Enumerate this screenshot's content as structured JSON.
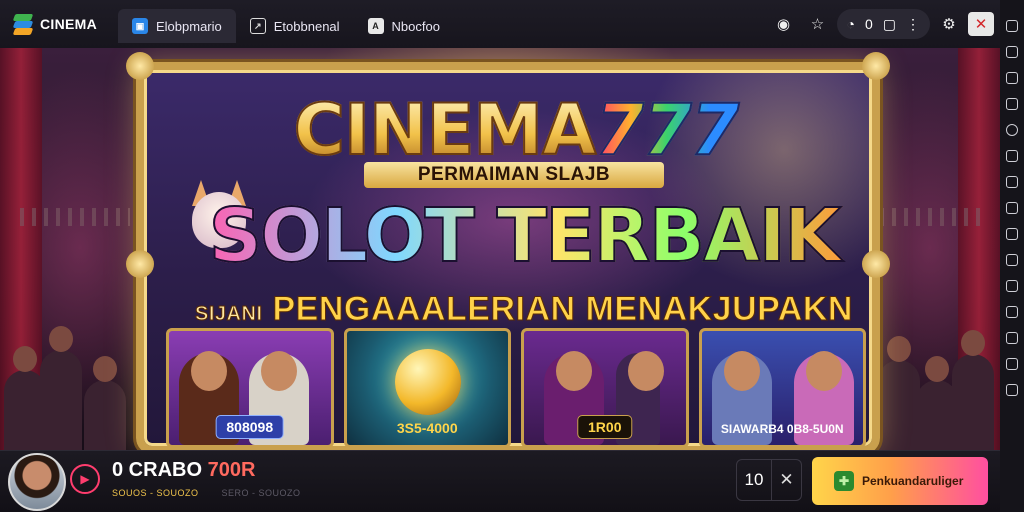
{
  "header": {
    "brand": "CINEMA",
    "tabs": [
      {
        "label": "Elobpmario",
        "icon": "app-icon"
      },
      {
        "label": "Etobbnenal",
        "icon": "window-icon"
      },
      {
        "label": "Nbocfoo",
        "icon": "document-icon"
      }
    ],
    "toolbar": {
      "share_icon": "share-icon",
      "star_icon": "star-icon",
      "pill_value": "0"
    }
  },
  "banner": {
    "brand_word": "CINEMA",
    "brand_number": "777",
    "subtitle": "PERMAIMAN SLAJB",
    "headline": "SOLOT TERBAIK",
    "tagline_prefix": "SIJANI",
    "tagline": "PENGAAALERIAN MENAKJUPAKN",
    "cards": [
      {
        "label": "808098",
        "label_bg": "#2d3fa8"
      },
      {
        "label": "3S5-4000",
        "label_bg": "transparent"
      },
      {
        "label": "1R00",
        "label_bg": "#1a1208"
      },
      {
        "label": "SIAWARB4 0B8-5U0N",
        "label_bg": "transparent"
      }
    ]
  },
  "player": {
    "credit_prefix": "0 CRABO",
    "credit_value": "700R",
    "credit_sub": "SOUOS - SOUOZO",
    "credit_sub_dim": "SERO - SOUOZO",
    "count": "10",
    "cta_label": "Penkuandaruliger"
  },
  "colors": {
    "accent": "#ff3d6e",
    "gold": "#c9a04d",
    "cta_start": "#ffd54a",
    "cta_end": "#ff4fa0"
  }
}
